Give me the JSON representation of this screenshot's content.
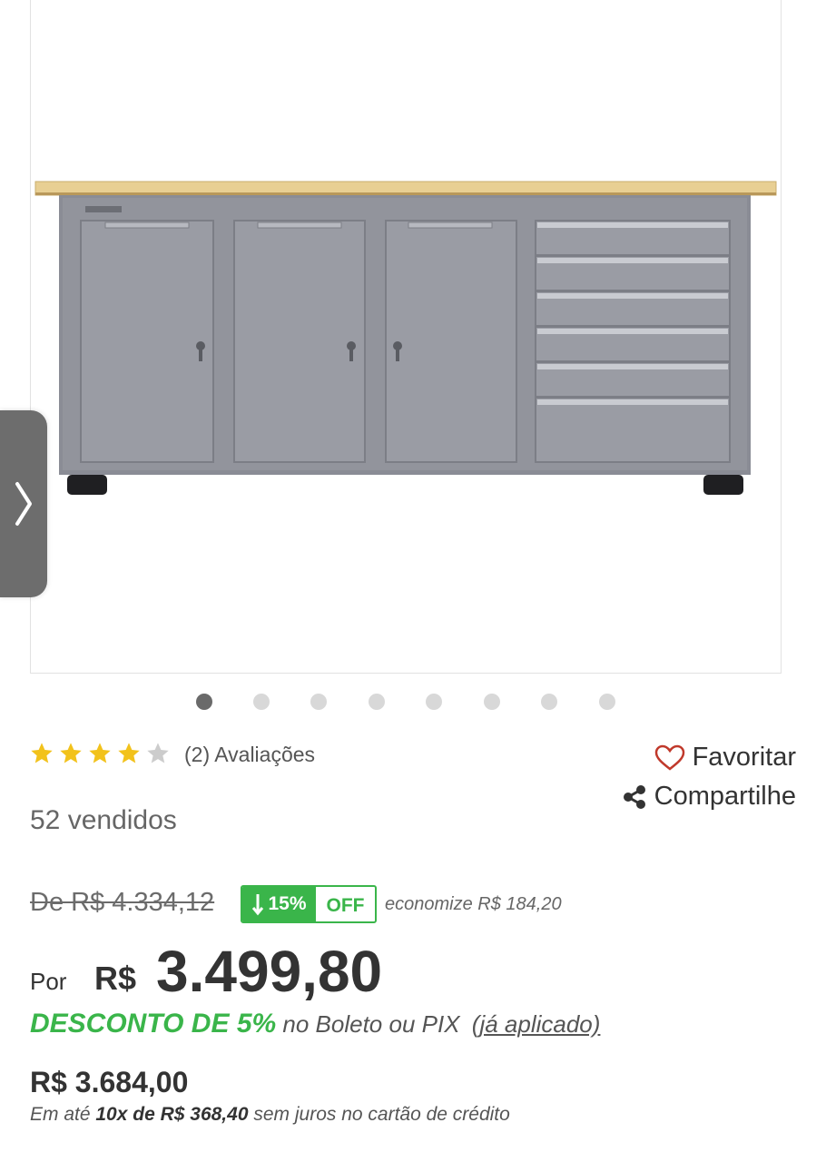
{
  "gallery": {
    "image_alt": "Bancada de ferramentas cinza com tampo de madeira",
    "dots_count": 8,
    "active_dot": 0,
    "next_icon": "chevron-right-icon"
  },
  "rating": {
    "stars_filled": 4,
    "stars_total": 5,
    "reviews_label": "(2) Avaliações",
    "star_color": "#f2c21b",
    "star_empty_color": "#cccccc"
  },
  "actions": {
    "favorite_label": "Favoritar",
    "share_label": "Compartilhe"
  },
  "sold_label": "52 vendidos",
  "pricing": {
    "old_price": "De R$ 4.334,12",
    "discount_percent": "15%",
    "off_label": "OFF",
    "economize": "economize R$ 184,20",
    "por_label": "Por",
    "currency": "R$",
    "price": "3.499,80",
    "discount_strong": "DESCONTO DE 5%",
    "discount_rest": "no Boleto ou PIX",
    "applied": "(já aplicado)",
    "card_price": "R$ 3.684,00",
    "installments_prefix": "Em até",
    "installments_bold": "10x de R$ 368,40",
    "installments_suffix": "sem juros no cartão de crédito",
    "accent_color": "#3ab54a"
  }
}
